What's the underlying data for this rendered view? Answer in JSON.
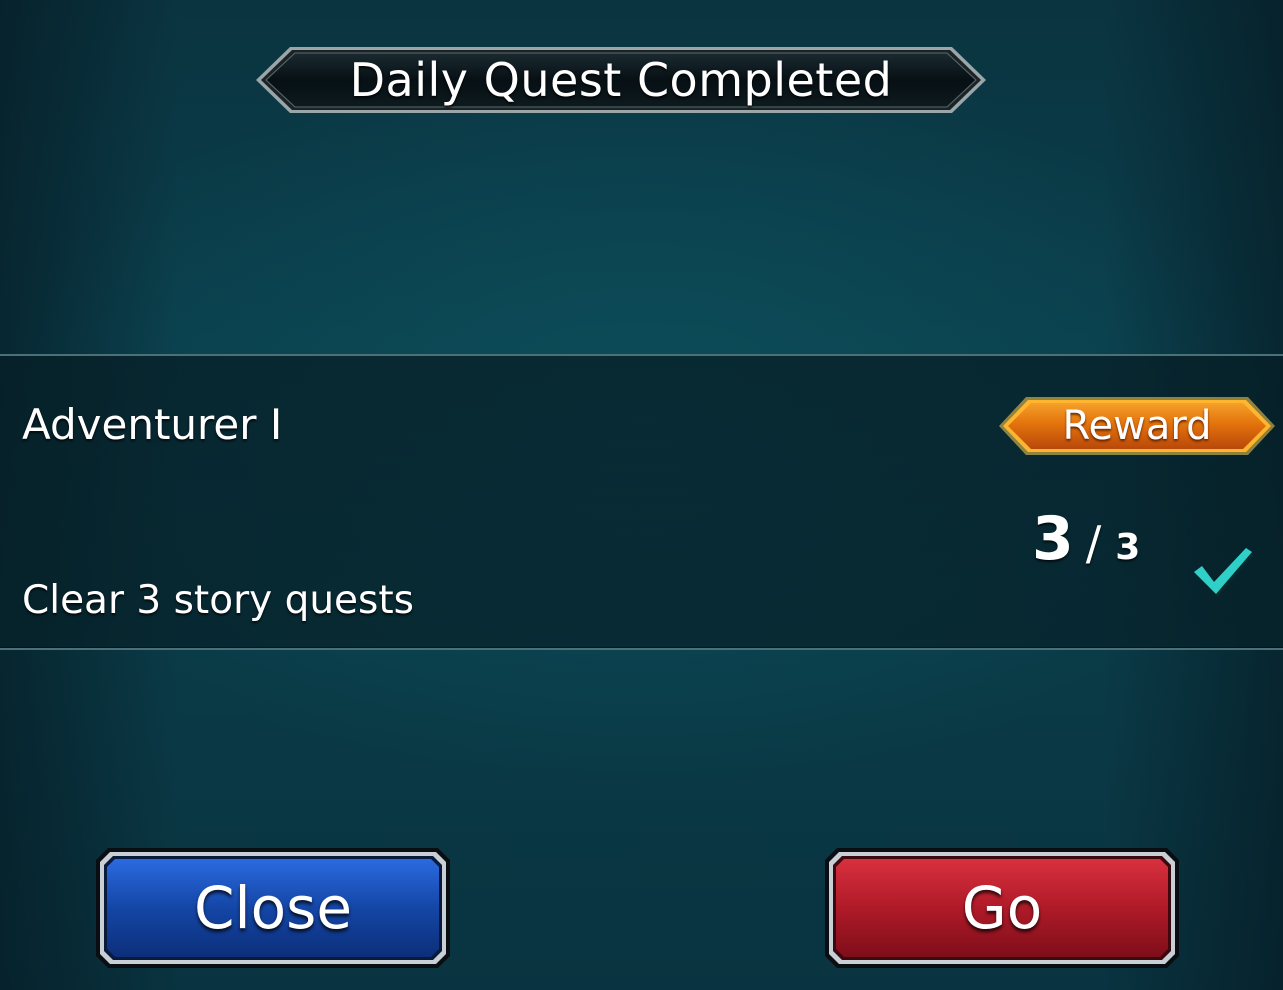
{
  "header": {
    "title": "Daily Quest Completed"
  },
  "quest": {
    "name": "Adventurer I",
    "description": "Clear 3 story quests",
    "reward_label": "Reward",
    "progress": {
      "current": "3",
      "separator": "/",
      "total": "3"
    },
    "status_icon": "checkmark-icon"
  },
  "buttons": {
    "close_label": "Close",
    "go_label": "Go"
  },
  "colors": {
    "background": "#0a3b47",
    "reward_orange": "#e8740c",
    "reward_border": "#ffc23a",
    "close_blue": "#1647a8",
    "go_red": "#b51a2a",
    "check_teal": "#2fd0c8"
  }
}
